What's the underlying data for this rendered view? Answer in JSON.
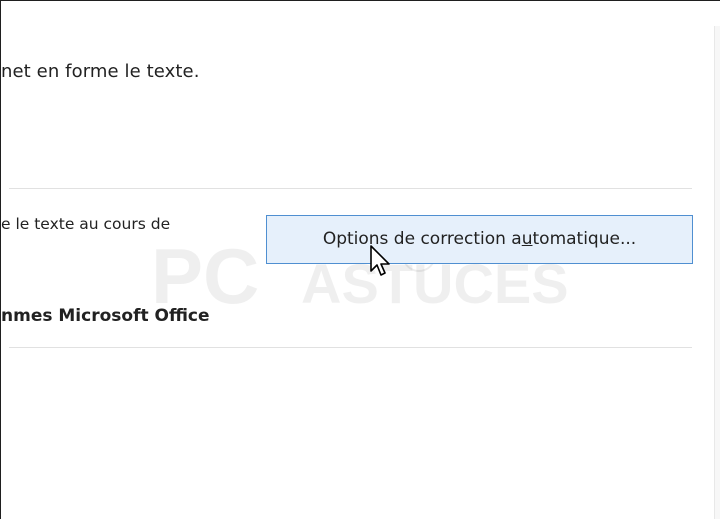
{
  "text": {
    "description_fragment": "net en forme le texte.",
    "autocorrect_description_fragment": "e le texte au cours de",
    "office_section_heading": "nmes Microsoft Office"
  },
  "autocorrect_button": {
    "label_before": "Options de correction a",
    "label_underlined": "u",
    "label_after": "tomatique..."
  },
  "watermark": {
    "primary": "PC",
    "secondary": "ASTUCES"
  },
  "colors": {
    "button_border": "#4f8fd1",
    "button_background": "#e6f0fb",
    "separator": "#e1e1e1"
  }
}
